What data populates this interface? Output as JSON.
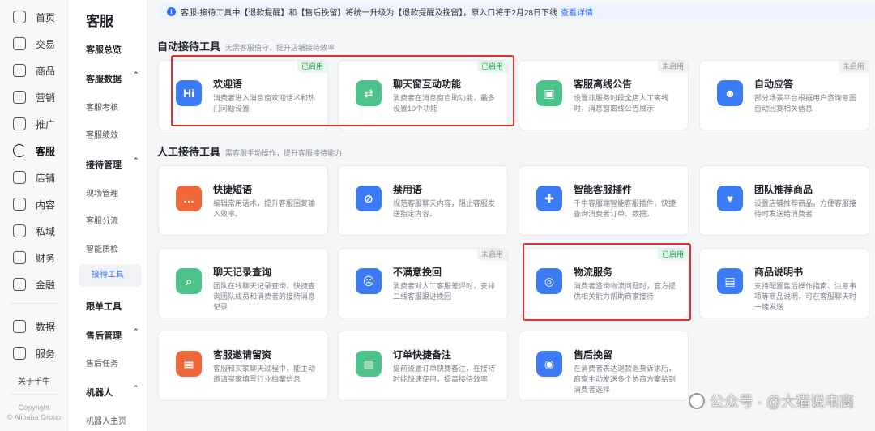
{
  "rail": {
    "items": [
      {
        "label": "首页",
        "icon": "home-icon"
      },
      {
        "label": "交易",
        "icon": "receipt-icon"
      },
      {
        "label": "商品",
        "icon": "box-icon"
      },
      {
        "label": "营销",
        "icon": "megaphone-icon"
      },
      {
        "label": "推广",
        "icon": "lightbulb-icon"
      },
      {
        "label": "客服",
        "icon": "headset-icon",
        "active": true
      },
      {
        "label": "店铺",
        "icon": "store-icon"
      },
      {
        "label": "内容",
        "icon": "content-icon"
      },
      {
        "label": "私域",
        "icon": "hashtag-icon"
      },
      {
        "label": "财务",
        "icon": "wallet-icon"
      },
      {
        "label": "金融",
        "icon": "coin-icon"
      },
      {
        "label": "数据",
        "icon": "chart-icon"
      },
      {
        "label": "服务",
        "icon": "grid-icon"
      }
    ],
    "about": "关于千牛",
    "copyright_line1": "Copyright",
    "copyright_line2": "© Alibaba Group"
  },
  "sidebar": {
    "title": "客服",
    "overview": "客服总览",
    "data_group": "客服数据",
    "data_items": [
      "客服考核",
      "客服绩效"
    ],
    "reception_group": "接待管理",
    "reception_items": [
      "现场管理",
      "客服分流",
      "智能质检",
      "接待工具"
    ],
    "follow": "跟单工具",
    "aftersale_group": "售后管理",
    "aftersale_items": [
      "售后任务"
    ],
    "robot_group": "机器人",
    "robot_items": [
      "机器人主页"
    ]
  },
  "notice": {
    "text": "客服-接待工具中【退款提醒】和【售后挽留】将统一升级为【退款提醒及挽留】，原入口将于2月28日下线",
    "link": "查看详情"
  },
  "auto_section": {
    "title": "自动接待工具",
    "subtitle": "无需客服值守，提升店铺接待效率",
    "cards": [
      {
        "title": "欢迎语",
        "desc": "消费者进入消息窗欢迎话术和热门问题设置",
        "badge": "已启用",
        "color": "#3d7bf6",
        "glyph": "Hi"
      },
      {
        "title": "聊天窗互动功能",
        "desc": "消费者在消息窗自助功能，最多设置10个功能",
        "badge": "已启用",
        "color": "#4cc38a",
        "glyph": "⇄"
      },
      {
        "title": "客服离线公告",
        "desc": "设置非服务时段全店人工离线时，消息窗离线公告展示",
        "badge": "未启用",
        "color": "#4cc38a",
        "glyph": "▣"
      },
      {
        "title": "自动应答",
        "desc": "部分场景平台根据用户咨询意图自动回复相关信息",
        "badge": "未启用",
        "color": "#3d7bf6",
        "glyph": "☻"
      }
    ]
  },
  "manual_section": {
    "title": "人工接待工具",
    "subtitle": "需客服手动操作，提升客服接待能力",
    "cards": [
      {
        "title": "快捷短语",
        "desc": "编辑常用话术，提升客服回复输入效率。",
        "badge": "",
        "color": "#f0683a",
        "glyph": "…"
      },
      {
        "title": "禁用语",
        "desc": "规范客服聊天内容，阻止客服发送指定内容。",
        "badge": "",
        "color": "#3d7bf6",
        "glyph": "⊘"
      },
      {
        "title": "智能客服插件",
        "desc": "千牛客服端智能客服插件，快捷查询消费者订单、数据。",
        "badge": "",
        "color": "#3d7bf6",
        "glyph": "✚"
      },
      {
        "title": "团队推荐商品",
        "desc": "设置店铺推荐商品，方便客服接待时发送给消费者",
        "badge": "",
        "color": "#3d7bf6",
        "glyph": "♥"
      },
      {
        "title": "聊天记录查询",
        "desc": "团队在线聊天记录查询，快捷查询团队成员和消费者的接待消息记录",
        "badge": "",
        "color": "#4cc38a",
        "glyph": "⌕"
      },
      {
        "title": "不满意挽回",
        "desc": "消费者对人工客服差评时，安排二线客服跟进挽回",
        "badge": "未启用",
        "color": "#3d7bf6",
        "glyph": "☹"
      },
      {
        "title": "物流服务",
        "desc": "消费者咨询物流问题时，官方提供相关能力帮助商家接待",
        "badge": "已启用",
        "color": "#3d7bf6",
        "glyph": "◎"
      },
      {
        "title": "商品说明书",
        "desc": "支持配置售后操作指南、注意事项等商品说明，可在客服聊天时一键发送",
        "badge": "",
        "color": "#3d7bf6",
        "glyph": "▤"
      },
      {
        "title": "客服邀请留资",
        "desc": "客服和买家聊天过程中，能主动邀请买家填写行业档案信息",
        "badge": "",
        "color": "#f0683a",
        "glyph": "▦"
      },
      {
        "title": "订单快捷备注",
        "desc": "提前设置订单快捷备注，在接待时能快速使用，提高接待效率",
        "badge": "",
        "color": "#4cc38a",
        "glyph": "▥"
      },
      {
        "title": "售后挽留",
        "desc": "在消费者表达退款退货诉求后，商家主动发送多个协商方案给到消费者选择",
        "badge": "",
        "color": "#3d7bf6",
        "glyph": "◉"
      }
    ]
  },
  "watermark": "公众号 · @大猫说电商"
}
